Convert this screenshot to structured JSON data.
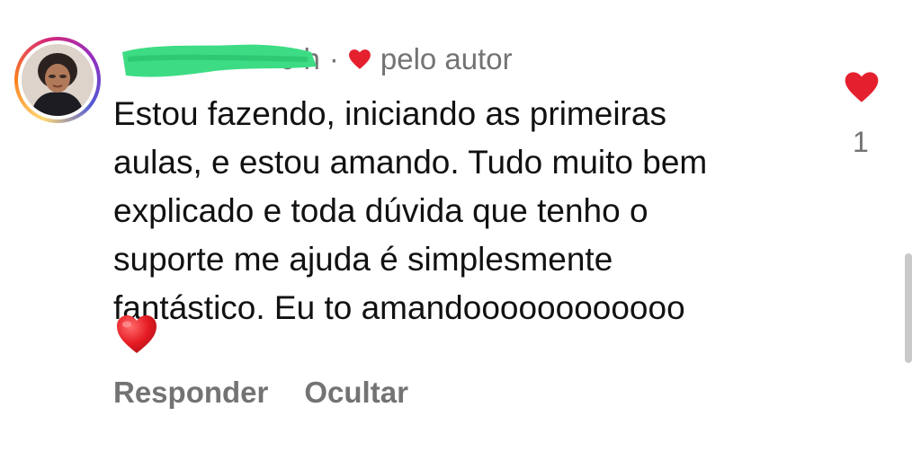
{
  "comment": {
    "username": "",
    "time": "6 h",
    "separator": "·",
    "liked_by_author_label": "pelo autor",
    "text_lines": [
      "Estou fazendo, iniciando as primeiras",
      "aulas, e estou amando. Tudo muito bem",
      "explicado e toda dúvida que tenho o",
      "suporte me ajuda é simplesmente",
      "fantástico. Eu to amandoooooooooooo"
    ],
    "like_count": "1"
  },
  "actions": {
    "reply_label": "Responder",
    "hide_label": "Ocultar"
  },
  "icons": {
    "author_like": "heart-icon",
    "like": "heart-icon",
    "emoji": "red-heart-emoji"
  },
  "colors": {
    "heart_red": "#e5202e",
    "meta_gray": "#737373",
    "redaction_green": "#3ddc84"
  }
}
